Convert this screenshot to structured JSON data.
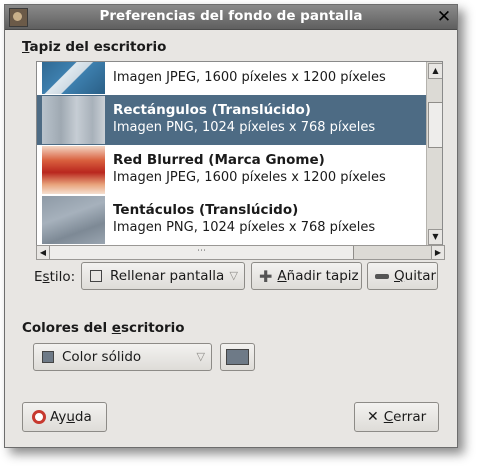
{
  "window": {
    "title": "Preferencias del fondo de pantalla"
  },
  "wallpaper_section": {
    "label_prefix": "",
    "label_accel": "T",
    "label_rest": "apiz del escritorio"
  },
  "wallpapers": [
    {
      "name": "",
      "desc": "Imagen JPEG, 1600 píxeles x 1200 píxeles",
      "thumb": "blue-swirl"
    },
    {
      "name": "Rectángulos (Translúcido)",
      "desc": "Imagen PNG, 1024 píxeles x 768 píxeles",
      "thumb": "rectangles",
      "selected": true
    },
    {
      "name": "Red Blurred (Marca Gnome)",
      "desc": "Imagen JPEG, 1600 píxeles x 1200 píxeles",
      "thumb": "red-blur"
    },
    {
      "name": "Tentáculos (Translúcido)",
      "desc": "Imagen PNG, 1024 píxeles x 768 píxeles",
      "thumb": "tentacles"
    }
  ],
  "style": {
    "label_prefix": "E",
    "label_accel": "s",
    "label_rest": "tilo:",
    "selected": "Rellenar pantalla"
  },
  "add_button": {
    "prefix": "",
    "accel": "A",
    "rest": "ñadir tapiz"
  },
  "remove_button": {
    "prefix": "",
    "accel": "Q",
    "rest": "uitar"
  },
  "colors_section": {
    "prefix": "Colores del ",
    "accel": "e",
    "rest": "scritorio"
  },
  "color_mode": {
    "selected": "Color sólido",
    "color": "#6e7a87"
  },
  "help_button": {
    "prefix": "Ay",
    "accel": "u",
    "rest": "da"
  },
  "close_button": {
    "prefix": "",
    "accel": "C",
    "rest": "errar"
  },
  "colors": {
    "selection": "#4d6b84",
    "titlebar": "#6f6f6f",
    "solid_color": "#6e7a87"
  }
}
